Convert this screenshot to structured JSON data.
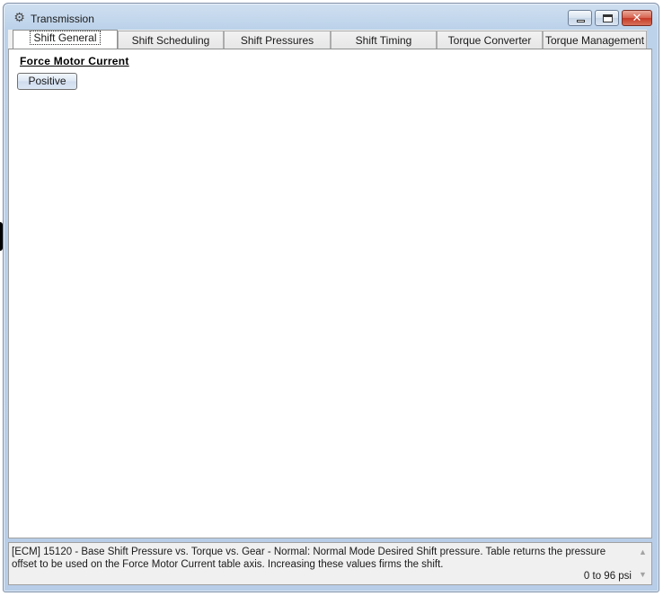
{
  "window": {
    "title": "Transmission",
    "icon": "gear-icon"
  },
  "tabs": [
    {
      "label": "Shift General",
      "active": true
    },
    {
      "label": "Shift Scheduling",
      "active": false
    },
    {
      "label": "Shift Pressures",
      "active": false
    },
    {
      "label": "Shift Timing",
      "active": false
    },
    {
      "label": "Torque Converter",
      "active": false
    },
    {
      "label": "Torque Management",
      "active": false
    }
  ],
  "panel": {
    "section_title": "Force Motor Current",
    "button_label": "Positive"
  },
  "info": {
    "description": "[ECM] 15120 - Base Shift Pressure vs. Torque vs. Gear - Normal: Normal Mode Desired Shift pressure. Table returns the pressure offset to be used on the Force Motor Current table axis. Increasing these values firms the shift.",
    "range": "0 to 96 psi"
  }
}
